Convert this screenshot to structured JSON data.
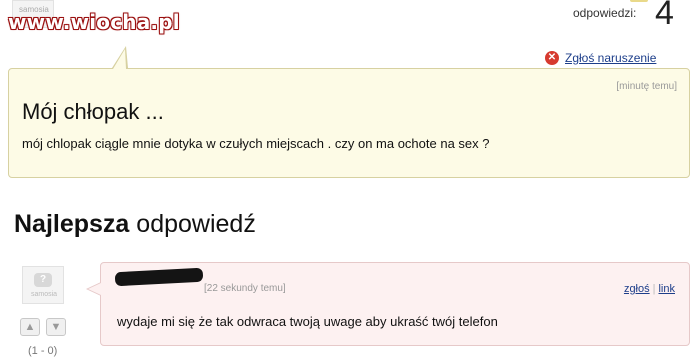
{
  "watermark": "www.wiocha.pl",
  "asker": {
    "avatar_text": "samosia"
  },
  "header": {
    "answers_label": "odpowiedzi:",
    "answers_count": "4"
  },
  "question": {
    "report_label": "Zgłoś naruszenie",
    "time": "[minutę temu]",
    "title": "Mój chłopak ...",
    "body": "mój chlopak ciągle mnie dotyka w czułych miejscach . czy on ma ochote na sex ?"
  },
  "best_answer": {
    "heading_bold": "Najlepsza",
    "heading_rest": " odpowiedź",
    "avatar_text": "samosia",
    "time": "[22 sekundy temu]",
    "report_label": "zgłoś",
    "link_label": "link",
    "separator": "|",
    "body": "wydaje mi się że tak odwraca twoją uwage aby ukraść twój telefon",
    "votes": "(1 - 0)"
  },
  "icons": {
    "report": "report-x-icon",
    "vote_up": "thumb-up-icon",
    "vote_down": "thumb-down-icon",
    "avatar": "avatar-icon"
  },
  "colors": {
    "link": "#1d3e8a",
    "question_bg": "#fdfbe6",
    "answer_bg": "#fdf1f1",
    "report_icon": "#d63a2f"
  }
}
